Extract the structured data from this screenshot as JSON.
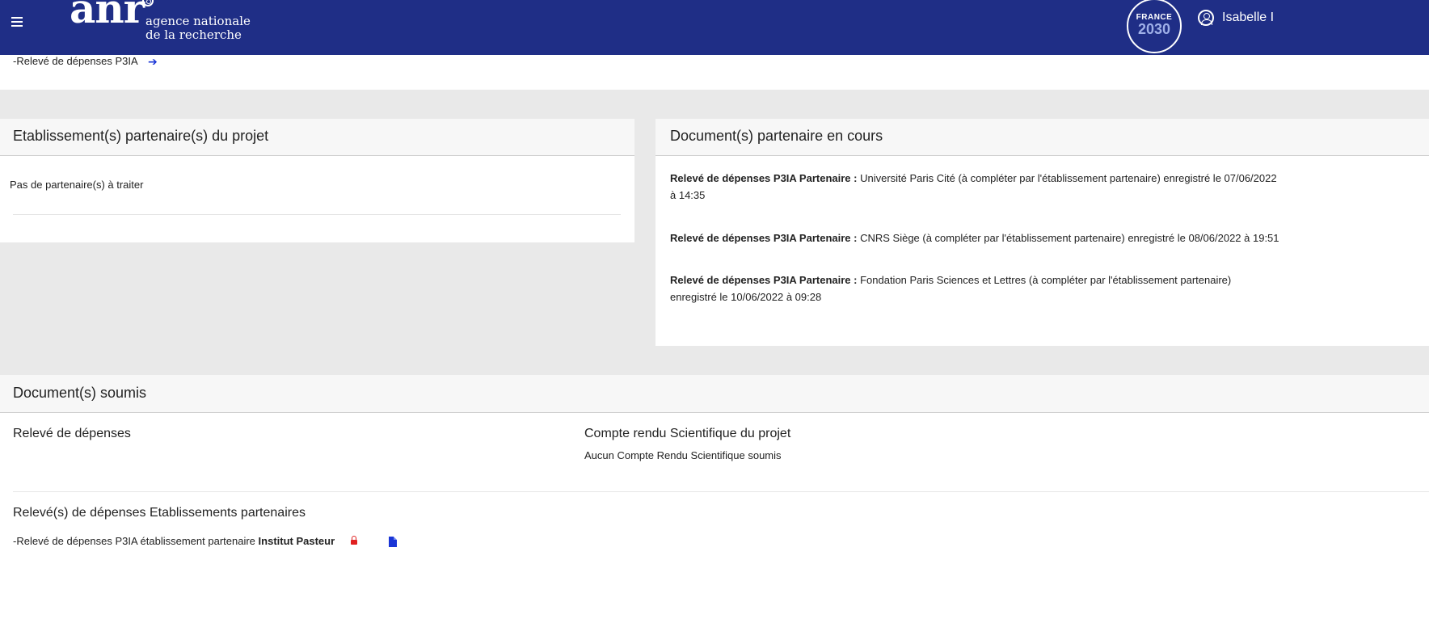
{
  "header": {
    "logo": "anr",
    "logo_line1": "agence nationale",
    "logo_line2": "de la recherche",
    "badge_line1": "FRANCE",
    "badge_line2": "2030",
    "user_name": "Isabelle I"
  },
  "top_link": {
    "label": "-Relevé de dépenses P3IA",
    "icon": "arrow-right-icon"
  },
  "partners_panel": {
    "title": "Etablissement(s) partenaire(s) du projet",
    "empty_text": "Pas de partenaire(s) à traiter"
  },
  "docs_in_progress": {
    "title": "Document(s) partenaire en cours",
    "entries": [
      {
        "label": "Relevé de dépenses P3IA Partenaire :",
        "line1": " Université Paris Cité (à compléter par l'établissement partenaire) enregistré le 07/06/2022",
        "line2": "à 14:35"
      },
      {
        "label": "Relevé de dépenses P3IA Partenaire :",
        "line1": " CNRS Siège (à compléter par l'établissement partenaire) enregistré le 08/06/2022 à 19:51",
        "line2": ""
      },
      {
        "label": "Relevé de dépenses P3IA Partenaire :",
        "line1": " Fondation Paris Sciences et Lettres (à compléter par l'établissement partenaire)",
        "line2": "enregistré le 10/06/2022 à 09:28"
      }
    ]
  },
  "submitted": {
    "title": "Document(s) soumis",
    "expenses_title": "Relevé de dépenses",
    "scientific_title": "Compte rendu Scientifique du projet",
    "scientific_empty": "Aucun Compte Rendu Scientifique soumis",
    "partners_expenses_title": "Relevé(s) de dépenses Etablissements partenaires",
    "partner_item_prefix": "-Relevé de dépenses P3IA établissement partenaire ",
    "partner_item_name": "Institut Pasteur",
    "lock_icon": "lock-icon",
    "file_icon": "file-icon"
  }
}
